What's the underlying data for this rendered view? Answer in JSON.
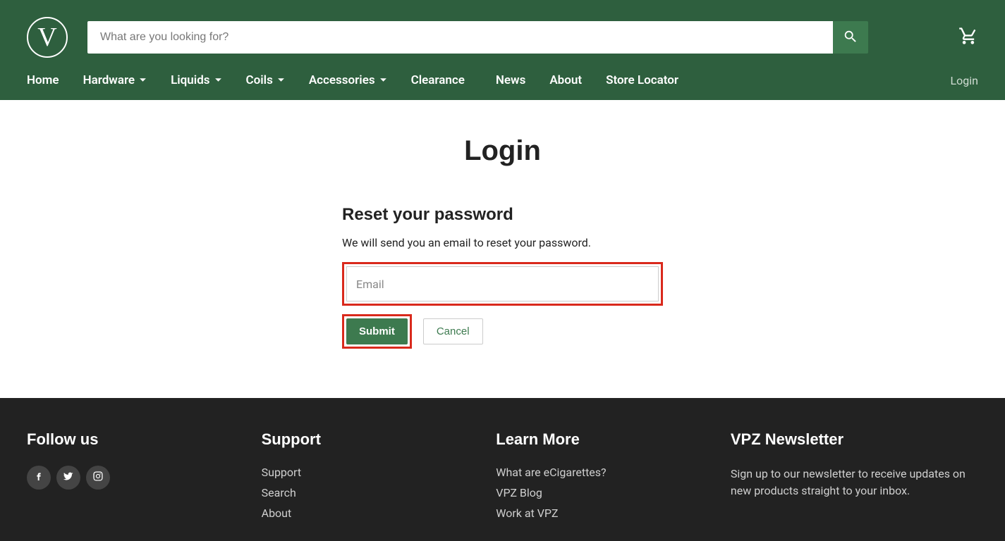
{
  "header": {
    "logo_letter": "V",
    "search_placeholder": "What are you looking for?"
  },
  "nav": {
    "items": [
      {
        "label": "Home",
        "dropdown": false
      },
      {
        "label": "Hardware",
        "dropdown": true
      },
      {
        "label": "Liquids",
        "dropdown": true
      },
      {
        "label": "Coils",
        "dropdown": true
      },
      {
        "label": "Accessories",
        "dropdown": true
      },
      {
        "label": "Clearance",
        "dropdown": false
      },
      {
        "label": "News",
        "dropdown": false
      },
      {
        "label": "About",
        "dropdown": false
      },
      {
        "label": "Store Locator",
        "dropdown": false
      }
    ],
    "login": "Login"
  },
  "main": {
    "title": "Login",
    "subtitle": "Reset your password",
    "desc": "We will send you an email to reset your password.",
    "email_label": "Email",
    "submit": "Submit",
    "cancel": "Cancel"
  },
  "footer": {
    "follow_title": "Follow us",
    "support_title": "Support",
    "support_links": [
      "Support",
      "Search",
      "About"
    ],
    "learn_title": "Learn More",
    "learn_links": [
      "What are eCigarettes?",
      "VPZ Blog",
      "Work at VPZ"
    ],
    "news_title": "VPZ Newsletter",
    "news_desc": "Sign up to our newsletter to receive updates on new products straight to your inbox."
  }
}
